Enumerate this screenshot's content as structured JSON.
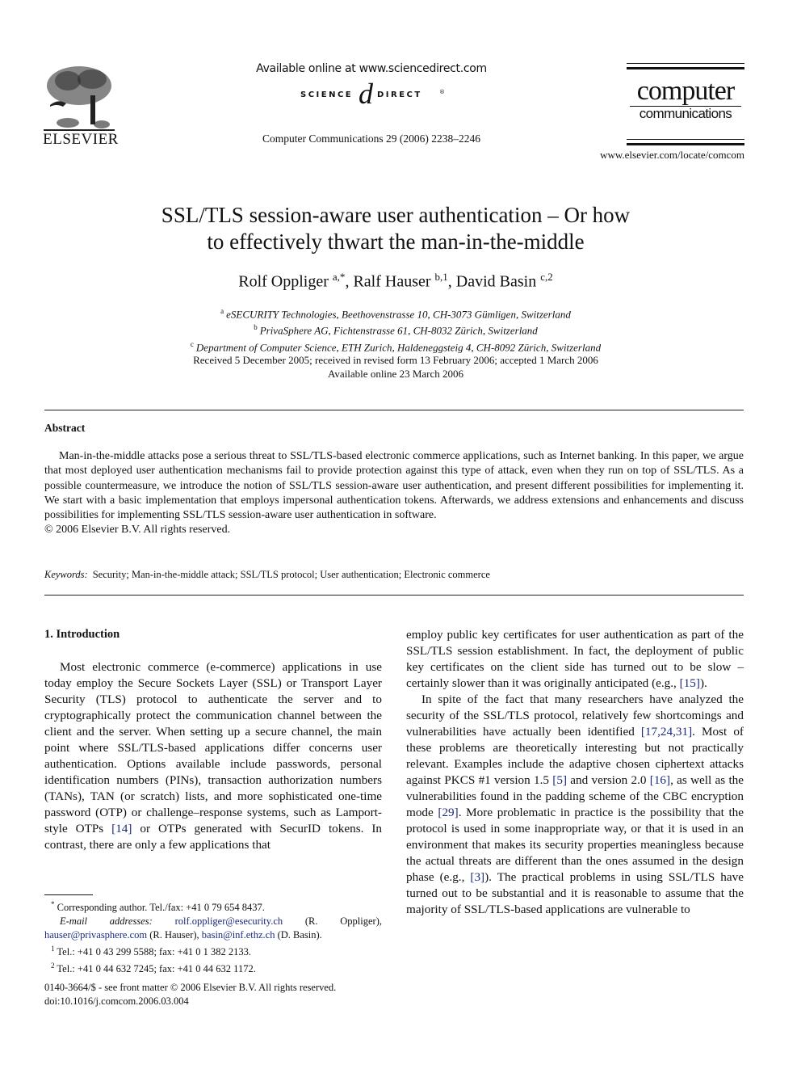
{
  "header": {
    "publisher_name": "ELSEVIER",
    "available_online": "Available online at www.sciencedirect.com",
    "sciencedirect_left": "SCIENCE",
    "sciencedirect_at": "d",
    "sciencedirect_right": "DIRECT",
    "sciencedirect_tm": "®",
    "journal_reference": "Computer Communications 29 (2006) 2238–2246",
    "journal_logo_line1": "computer",
    "journal_logo_line2": "communications",
    "journal_url": "www.elsevier.com/locate/comcom"
  },
  "article": {
    "title_line1": "SSL/TLS session-aware user authentication – Or how",
    "title_line2": "to effectively thwart the man-in-the-middle",
    "authors": [
      {
        "name": "Rolf Oppliger",
        "marks": "a,*",
        "sep": ", "
      },
      {
        "name": "Ralf Hauser",
        "marks": "b,1",
        "sep": ", "
      },
      {
        "name": "David Basin",
        "marks": "c,2",
        "sep": ""
      }
    ],
    "affiliations": [
      {
        "mark": "a",
        "text": "eSECURITY Technologies, Beethovenstrasse 10, CH-3073 Gümligen, Switzerland"
      },
      {
        "mark": "b",
        "text": "PrivaSphere AG, Fichtenstrasse 61, CH-8032 Zürich, Switzerland"
      },
      {
        "mark": "c",
        "text": "Department of Computer Science, ETH Zurich, Haldeneggsteig 4, CH-8092 Zürich, Switzerland"
      }
    ],
    "received": "Received 5 December 2005; received in revised form 13 February 2006; accepted 1 March 2006",
    "available": "Available online 23 March 2006"
  },
  "abstract": {
    "heading": "Abstract",
    "body": "Man-in-the-middle attacks pose a serious threat to SSL/TLS-based electronic commerce applications, such as Internet banking. In this paper, we argue that most deployed user authentication mechanisms fail to provide protection against this type of attack, even when they run on top of SSL/TLS. As a possible countermeasure, we introduce the notion of SSL/TLS session-aware user authentication, and present different possibilities for implementing it. We start with a basic implementation that employs impersonal authentication tokens. Afterwards, we address extensions and enhancements and discuss possibilities for implementing SSL/TLS session-aware user authentication in software.",
    "copyright": "© 2006 Elsevier B.V. All rights reserved.",
    "keywords_label": "Keywords:",
    "keywords": "Security; Man-in-the-middle attack; SSL/TLS protocol; User authentication; Electronic commerce"
  },
  "section1": {
    "heading": "1. Introduction",
    "left_p1_a": "Most electronic commerce (e-commerce) applications in use today employ the Secure Sockets Layer (SSL) or Transport Layer Security (TLS) protocol to authenticate the server and to cryptographically protect the communication channel between the client and the server. When setting up a secure channel, the main point where SSL/TLS-based applications differ concerns user authentication. Options available include passwords, personal identification numbers (PINs), transaction authorization numbers (TANs), TAN (or scratch) lists, and more sophisticated one-time password (OTP) or challenge–response systems, such as Lamport-style OTPs ",
    "ref_14": "[14]",
    "left_p1_b": " or OTPs generated with SecurID tokens. In contrast, there are only a few applications that",
    "right_p1_a": "employ public key certificates for user authentication as part of the SSL/TLS session establishment. In fact, the deployment of public key certificates on the client side has turned out to be slow – certainly slower than it was originally anticipated (e.g., ",
    "ref_15": "[15]",
    "right_p1_b": ").",
    "right_p2_a": "In spite of the fact that many researchers have analyzed the security of the SSL/TLS protocol, relatively few shortcomings and vulnerabilities have actually been identified ",
    "ref_17_24_31": "[17,24,31]",
    "right_p2_b": ". Most of these problems are theoretically interesting but not practically relevant. Examples include the adaptive chosen ciphertext attacks against PKCS #1 version 1.5 ",
    "ref_5": "[5]",
    "right_p2_c": " and version 2.0 ",
    "ref_16": "[16]",
    "right_p2_d": ", as well as the vulnerabilities found in the padding scheme of the CBC encryption mode ",
    "ref_29": "[29]",
    "right_p2_e": ". More problematic in practice is the possibility that the protocol is used in some inappropriate way, or that it is used in an environment that makes its security properties meaningless because the actual threats are different than the ones assumed in the design phase (e.g., ",
    "ref_3": "[3]",
    "right_p2_f": "). The practical problems in using SSL/TLS have turned out to be substantial and it is reasonable to assume that the majority of SSL/TLS-based applications are vulnerable to"
  },
  "footnotes": {
    "star_mark": "*",
    "corresponding": "Corresponding author. Tel./fax: +41 0 79 654 8437.",
    "email_label": "E-mail addresses:",
    "email1": "rolf.oppliger@esecurity.ch",
    "email1_owner": " (R. Oppliger), ",
    "email2": "hauser@privasphere.com",
    "email2_owner": " (R. Hauser), ",
    "email3": "basin@inf.ethz.ch",
    "email3_owner": " (D. Basin).",
    "fn1_mark": "1",
    "fn1": "Tel.: +41 0 43 299 5588; fax: +41 0 1 382 2133.",
    "fn2_mark": "2",
    "fn2": "Tel.: +41 0 44 632 7245; fax: +41 0 44 632 1172."
  },
  "front_matter": {
    "issn_line": "0140-3664/$ - see front matter © 2006 Elsevier B.V. All rights reserved.",
    "doi": "doi:10.1016/j.comcom.2006.03.004"
  },
  "colors": {
    "text": "#111111",
    "link": "#1a2a80"
  }
}
